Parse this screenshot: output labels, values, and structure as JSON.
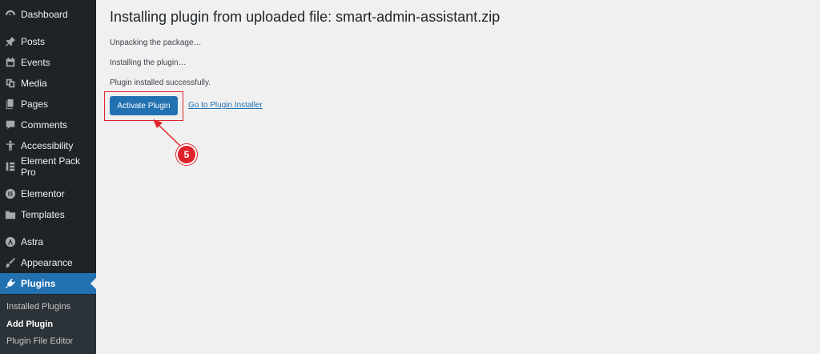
{
  "sidebar": {
    "items": [
      {
        "label": "Dashboard",
        "icon": "dashboard-icon"
      },
      {
        "label": "Posts",
        "icon": "pin-icon"
      },
      {
        "label": "Events",
        "icon": "calendar-icon"
      },
      {
        "label": "Media",
        "icon": "media-icon"
      },
      {
        "label": "Pages",
        "icon": "pages-icon"
      },
      {
        "label": "Comments",
        "icon": "comment-icon"
      },
      {
        "label": "Accessibility",
        "icon": "accessibility-icon"
      },
      {
        "label": "Element Pack Pro",
        "icon": "element-pack-icon"
      },
      {
        "label": "Elementor",
        "icon": "elementor-icon"
      },
      {
        "label": "Templates",
        "icon": "folder-icon"
      },
      {
        "label": "Astra",
        "icon": "astra-icon"
      },
      {
        "label": "Appearance",
        "icon": "brush-icon"
      },
      {
        "label": "Plugins",
        "icon": "plug-icon"
      }
    ],
    "submenu": [
      "Installed Plugins",
      "Add Plugin",
      "Plugin File Editor"
    ]
  },
  "main": {
    "title": "Installing plugin from uploaded file: smart-admin-assistant.zip",
    "messages": [
      "Unpacking the package…",
      "Installing the plugin…",
      "Plugin installed successfully."
    ],
    "activate_label": "Activate Plugin",
    "installer_link": "Go to Plugin Installer"
  },
  "annotation": {
    "step": "5"
  },
  "colors": {
    "sidebar_bg": "#1d2327",
    "accent": "#2271b1",
    "highlight": "#e0232b",
    "page_bg": "#f0f0f1"
  }
}
